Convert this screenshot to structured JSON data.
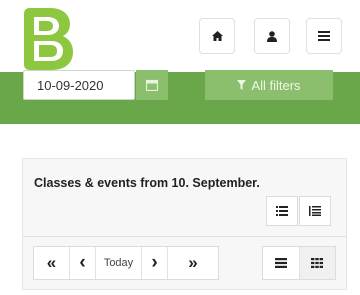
{
  "header": {
    "logo_letter": "B",
    "brand_color": "#8dc63f",
    "nav": [
      {
        "name": "home-icon"
      },
      {
        "name": "user-icon"
      },
      {
        "name": "menu-icon"
      }
    ]
  },
  "filters": {
    "date_value": "10-09-2020",
    "all_filters_label": "All filters",
    "band_color": "#6aa64a"
  },
  "panel": {
    "title": "Classes & events from 10. September.",
    "pager": {
      "first": "«",
      "prev": "‹",
      "today": "Today",
      "next": "›",
      "last": "»"
    }
  }
}
